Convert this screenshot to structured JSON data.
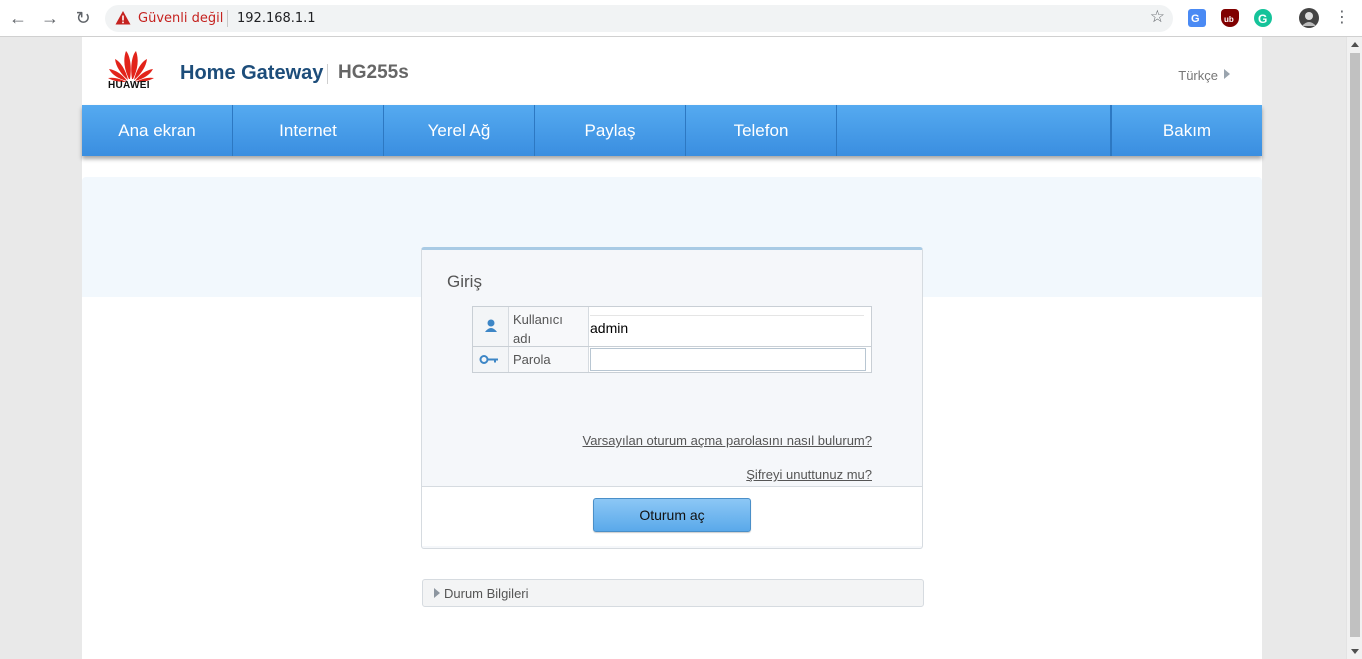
{
  "browser": {
    "security_label": "Güvenli değil",
    "url": "192.168.1.1",
    "icons": [
      "back-icon",
      "forward-icon",
      "reload-icon",
      "warning-icon",
      "bookmark-star-icon",
      "translate-extension-icon",
      "ublock-extension-icon",
      "grammarly-extension-icon",
      "profile-avatar-icon",
      "menu-icon"
    ]
  },
  "header": {
    "logo_text": "HUAWEI",
    "product": "Home Gateway",
    "model": "HG255s",
    "language": "Türkçe"
  },
  "menu": {
    "items": [
      {
        "label": "Ana ekran"
      },
      {
        "label": "Internet"
      },
      {
        "label": "Yerel Ağ"
      },
      {
        "label": "Paylaş"
      },
      {
        "label": "Telefon"
      },
      {
        "label": ""
      },
      {
        "label": "Bakım"
      }
    ]
  },
  "login": {
    "title": "Giriş",
    "username_label": "Kullanıcı adı",
    "username_value": "admin",
    "password_label": "Parola",
    "password_value": "",
    "default_password_link": "Varsayılan oturum açma parolasını nasıl bulurum?",
    "forgot_link": "Şifreyi unuttunuz mu?",
    "submit_label": "Oturum aç"
  },
  "status": {
    "label": "Durum Bilgileri"
  },
  "colors": {
    "menu_blue": "#3a8ee0",
    "title_blue": "#1d4d7a",
    "huawei_red": "#e2231a",
    "warning_red": "#c5221f"
  }
}
